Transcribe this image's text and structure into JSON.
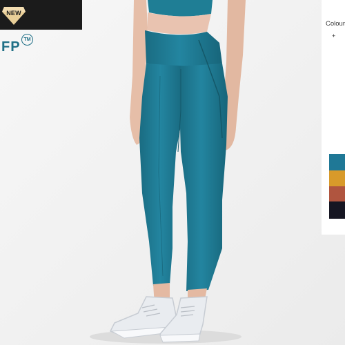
{
  "badge": {
    "text": "NEW"
  },
  "brand": {
    "name": "FP",
    "trademark": "TM"
  },
  "colour_selector": {
    "label": "Colour",
    "add_label": "+",
    "swatches": [
      {
        "name": "teal",
        "color": "#1f7896"
      },
      {
        "name": "mustard",
        "color": "#d89a2a"
      },
      {
        "name": "rust",
        "color": "#b0553f"
      },
      {
        "name": "black",
        "color": "#161622"
      }
    ]
  },
  "product_photo": {
    "legging_color": "#1f7e95",
    "shoe_color": "#e9ecf0"
  }
}
